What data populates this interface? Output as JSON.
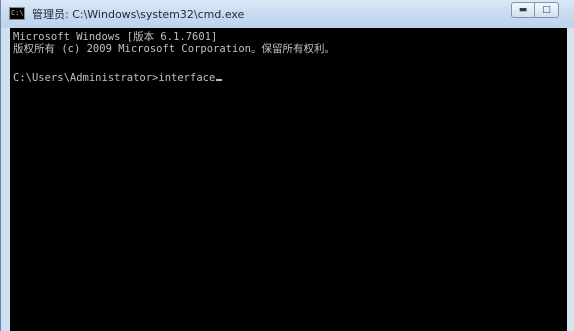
{
  "window": {
    "title": "管理员: C:\\Windows\\system32\\cmd.exe",
    "icon": "cmd-app-icon",
    "minimize_glyph": "▬",
    "maximize_glyph": "□"
  },
  "console": {
    "lines": [
      "Microsoft Windows [版本 6.1.7601]",
      "版权所有 (c) 2009 Microsoft Corporation。保留所有权利。",
      "",
      "C:\\Users\\Administrator>interface"
    ]
  },
  "colors": {
    "console_background": "#000000",
    "console_text": "#c0c0c0",
    "title_bar": "#cfe0f2"
  }
}
